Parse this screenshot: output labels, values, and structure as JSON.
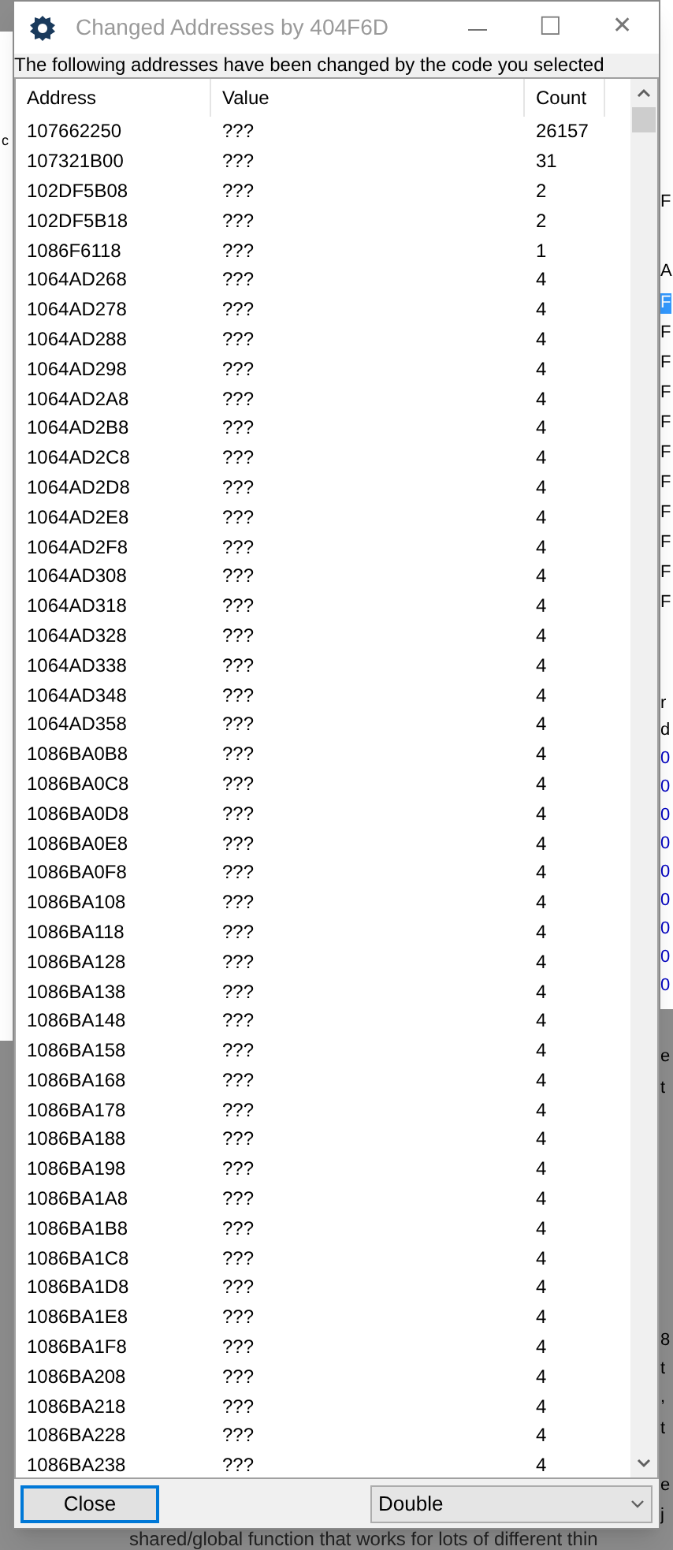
{
  "window": {
    "title": "Changed Addresses by 404F6D",
    "minimize": "—",
    "maximize": "☐",
    "close": "✕"
  },
  "message": "The following addresses have been changed by the code you selected",
  "table": {
    "columns": [
      "Address",
      "Value",
      "Count"
    ],
    "rows": [
      [
        "107662250",
        "???",
        "26157"
      ],
      [
        "107321B00",
        "???",
        "31"
      ],
      [
        "102DF5B08",
        "???",
        "2"
      ],
      [
        "102DF5B18",
        "???",
        "2"
      ],
      [
        "1086F6118",
        "???",
        "1"
      ],
      [
        "1064AD268",
        "???",
        "4"
      ],
      [
        "1064AD278",
        "???",
        "4"
      ],
      [
        "1064AD288",
        "???",
        "4"
      ],
      [
        "1064AD298",
        "???",
        "4"
      ],
      [
        "1064AD2A8",
        "???",
        "4"
      ],
      [
        "1064AD2B8",
        "???",
        "4"
      ],
      [
        "1064AD2C8",
        "???",
        "4"
      ],
      [
        "1064AD2D8",
        "???",
        "4"
      ],
      [
        "1064AD2E8",
        "???",
        "4"
      ],
      [
        "1064AD2F8",
        "???",
        "4"
      ],
      [
        "1064AD308",
        "???",
        "4"
      ],
      [
        "1064AD318",
        "???",
        "4"
      ],
      [
        "1064AD328",
        "???",
        "4"
      ],
      [
        "1064AD338",
        "???",
        "4"
      ],
      [
        "1064AD348",
        "???",
        "4"
      ],
      [
        "1064AD358",
        "???",
        "4"
      ],
      [
        "1086BA0B8",
        "???",
        "4"
      ],
      [
        "1086BA0C8",
        "???",
        "4"
      ],
      [
        "1086BA0D8",
        "???",
        "4"
      ],
      [
        "1086BA0E8",
        "???",
        "4"
      ],
      [
        "1086BA0F8",
        "???",
        "4"
      ],
      [
        "1086BA108",
        "???",
        "4"
      ],
      [
        "1086BA118",
        "???",
        "4"
      ],
      [
        "1086BA128",
        "???",
        "4"
      ],
      [
        "1086BA138",
        "???",
        "4"
      ],
      [
        "1086BA148",
        "???",
        "4"
      ],
      [
        "1086BA158",
        "???",
        "4"
      ],
      [
        "1086BA168",
        "???",
        "4"
      ],
      [
        "1086BA178",
        "???",
        "4"
      ],
      [
        "1086BA188",
        "???",
        "4"
      ],
      [
        "1086BA198",
        "???",
        "4"
      ],
      [
        "1086BA1A8",
        "???",
        "4"
      ],
      [
        "1086BA1B8",
        "???",
        "4"
      ],
      [
        "1086BA1C8",
        "???",
        "4"
      ],
      [
        "1086BA1D8",
        "???",
        "4"
      ],
      [
        "1086BA1E8",
        "???",
        "4"
      ],
      [
        "1086BA1F8",
        "???",
        "4"
      ],
      [
        "1086BA208",
        "???",
        "4"
      ],
      [
        "1086BA218",
        "???",
        "4"
      ],
      [
        "1086BA228",
        "???",
        "4"
      ],
      [
        "1086BA238",
        "???",
        "4"
      ]
    ]
  },
  "close_button": "Close",
  "type_dropdown": {
    "value": "Double"
  },
  "background": {
    "right_fragments": [
      {
        "text": "F",
        "kind": "text",
        "selected": false
      },
      {
        "text": "A",
        "kind": "text",
        "selected": false
      },
      {
        "text": "F",
        "kind": "text",
        "selected": true
      },
      {
        "text": "F",
        "kind": "text",
        "selected": false
      },
      {
        "text": "F",
        "kind": "text",
        "selected": false
      },
      {
        "text": "F",
        "kind": "text",
        "selected": false
      },
      {
        "text": "F",
        "kind": "text",
        "selected": false
      },
      {
        "text": "F",
        "kind": "text",
        "selected": false
      },
      {
        "text": "F",
        "kind": "text",
        "selected": false
      },
      {
        "text": "F",
        "kind": "text",
        "selected": false
      },
      {
        "text": "F",
        "kind": "text",
        "selected": false
      },
      {
        "text": "F",
        "kind": "text",
        "selected": false
      },
      {
        "text": "F",
        "kind": "text",
        "selected": false
      },
      {
        "text": "r",
        "kind": "text",
        "selected": false
      },
      {
        "text": "d",
        "kind": "text",
        "selected": false
      },
      {
        "text": "0",
        "kind": "number",
        "selected": false
      },
      {
        "text": "0",
        "kind": "number",
        "selected": false
      },
      {
        "text": "0",
        "kind": "number",
        "selected": false
      },
      {
        "text": "0",
        "kind": "number",
        "selected": false
      },
      {
        "text": "0",
        "kind": "number",
        "selected": false
      },
      {
        "text": "0",
        "kind": "number",
        "selected": false
      },
      {
        "text": "0",
        "kind": "number",
        "selected": false
      },
      {
        "text": "0",
        "kind": "number",
        "selected": false
      },
      {
        "text": "0",
        "kind": "number",
        "selected": false
      },
      {
        "text": "e",
        "kind": "text",
        "selected": false
      },
      {
        "text": "t",
        "kind": "text",
        "selected": false
      },
      {
        "text": "8",
        "kind": "text",
        "selected": false
      },
      {
        "text": "t",
        "kind": "text",
        "selected": false
      },
      {
        "text": ",",
        "kind": "text",
        "selected": false
      },
      {
        "text": "t",
        "kind": "text",
        "selected": false
      },
      {
        "text": "e",
        "kind": "text",
        "selected": false
      },
      {
        "text": "j",
        "kind": "text",
        "selected": false
      }
    ],
    "bottom_text": "shared/global function that works for lots of different thin",
    "left_fragment": "c"
  }
}
